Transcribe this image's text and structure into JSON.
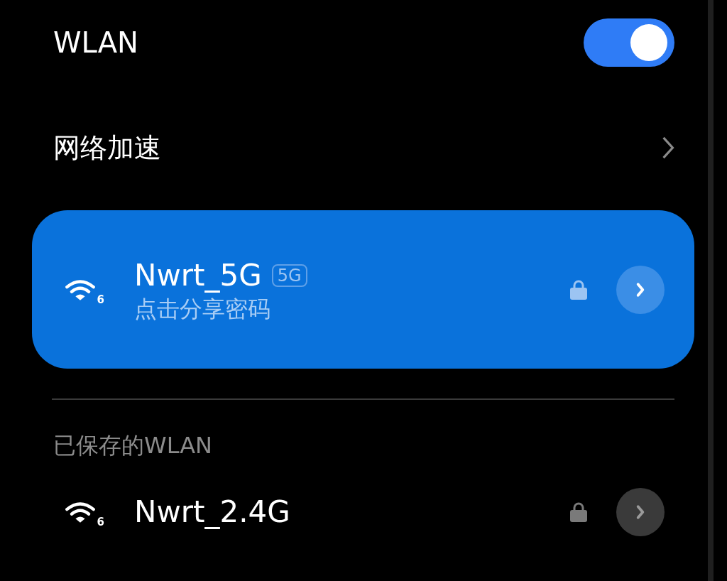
{
  "wlan": {
    "label": "WLAN",
    "on": true
  },
  "acceleration": {
    "label": "网络加速"
  },
  "current_networks": [
    {
      "name": "Nwrt_5G",
      "band_badge": "5G",
      "subtitle": "点击分享密码",
      "standard": "6",
      "secured": true,
      "connected": true
    }
  ],
  "saved_section": {
    "title": "已保存的WLAN"
  },
  "saved_networks": [
    {
      "name": "Nwrt_2.4G",
      "standard": "6",
      "secured": true,
      "connected": false
    }
  ]
}
